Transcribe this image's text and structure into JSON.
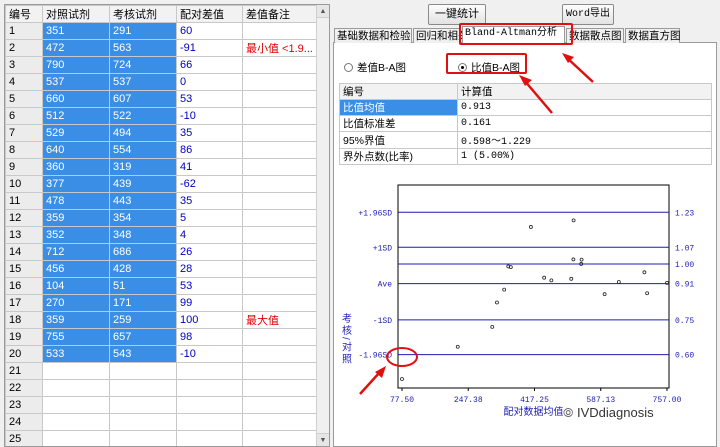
{
  "grid": {
    "headers": [
      "编号",
      "对照试剂",
      "考核试剂",
      "配对差值",
      "差值备注"
    ],
    "rows": [
      {
        "n": "1",
        "ref": "351",
        "test": "291",
        "diff": "60",
        "note": ""
      },
      {
        "n": "2",
        "ref": "472",
        "test": "563",
        "diff": "-91",
        "note": "最小值 <1.9..."
      },
      {
        "n": "3",
        "ref": "790",
        "test": "724",
        "diff": "66",
        "note": ""
      },
      {
        "n": "4",
        "ref": "537",
        "test": "537",
        "diff": "0",
        "note": ""
      },
      {
        "n": "5",
        "ref": "660",
        "test": "607",
        "diff": "53",
        "note": ""
      },
      {
        "n": "6",
        "ref": "512",
        "test": "522",
        "diff": "-10",
        "note": ""
      },
      {
        "n": "7",
        "ref": "529",
        "test": "494",
        "diff": "35",
        "note": ""
      },
      {
        "n": "8",
        "ref": "640",
        "test": "554",
        "diff": "86",
        "note": ""
      },
      {
        "n": "9",
        "ref": "360",
        "test": "319",
        "diff": "41",
        "note": ""
      },
      {
        "n": "10",
        "ref": "377",
        "test": "439",
        "diff": "-62",
        "note": ""
      },
      {
        "n": "11",
        "ref": "478",
        "test": "443",
        "diff": "35",
        "note": ""
      },
      {
        "n": "12",
        "ref": "359",
        "test": "354",
        "diff": "5",
        "note": ""
      },
      {
        "n": "13",
        "ref": "352",
        "test": "348",
        "diff": "4",
        "note": ""
      },
      {
        "n": "14",
        "ref": "712",
        "test": "686",
        "diff": "26",
        "note": ""
      },
      {
        "n": "15",
        "ref": "456",
        "test": "428",
        "diff": "28",
        "note": ""
      },
      {
        "n": "16",
        "ref": "104",
        "test": "51",
        "diff": "53",
        "note": ""
      },
      {
        "n": "17",
        "ref": "270",
        "test": "171",
        "diff": "99",
        "note": ""
      },
      {
        "n": "18",
        "ref": "359",
        "test": "259",
        "diff": "100",
        "note": "最大值"
      },
      {
        "n": "19",
        "ref": "755",
        "test": "657",
        "diff": "98",
        "note": ""
      },
      {
        "n": "20",
        "ref": "533",
        "test": "543",
        "diff": "-10",
        "note": ""
      },
      {
        "n": "21",
        "ref": "",
        "test": "",
        "diff": "",
        "note": ""
      },
      {
        "n": "22",
        "ref": "",
        "test": "",
        "diff": "",
        "note": ""
      },
      {
        "n": "23",
        "ref": "",
        "test": "",
        "diff": "",
        "note": ""
      },
      {
        "n": "24",
        "ref": "",
        "test": "",
        "diff": "",
        "note": ""
      },
      {
        "n": "25",
        "ref": "",
        "test": "",
        "diff": "",
        "note": ""
      }
    ]
  },
  "toolbar": {
    "stats_label": "一键统计",
    "word_label": "Word导出"
  },
  "tabs": [
    {
      "label": "基础数据和检验",
      "active": false
    },
    {
      "label": "回归和相关",
      "active": false
    },
    {
      "label": "Bland-Altman分析",
      "active": true
    },
    {
      "label": "数据散点图",
      "active": false
    },
    {
      "label": "数据直方图",
      "active": false
    }
  ],
  "radios": [
    {
      "label": "差值B-A图",
      "checked": false
    },
    {
      "label": "比值B-A图",
      "checked": true
    }
  ],
  "result": {
    "headers": [
      "编号",
      "计算值"
    ],
    "rows": [
      {
        "label": "比值均值",
        "value": "0.913",
        "selected": true
      },
      {
        "label": "比值标准差",
        "value": "0.161",
        "selected": false
      },
      {
        "label": "95%界值",
        "value": "0.598～1.229",
        "selected": false
      },
      {
        "label": "界外点数(比率)",
        "value": "1 (5.00%)",
        "selected": false
      }
    ]
  },
  "chart_data": {
    "type": "scatter",
    "xlabel": "配对数据均值",
    "ylabel": "考核/对照",
    "x_ticks": [
      "77.50",
      "247.38",
      "417.25",
      "587.13",
      "757.00"
    ],
    "xlim": [
      77.5,
      757.0
    ],
    "ylim": [
      0.45,
      1.35
    ],
    "hlines": [
      {
        "left": "+1.96SD",
        "right": "1.23",
        "value": 1.229
      },
      {
        "left": "+1SD",
        "right": "1.07",
        "value": 1.074
      },
      {
        "left": "",
        "right": "1.00",
        "value": 1.0
      },
      {
        "left": "Ave",
        "right": "0.91",
        "value": 0.913
      },
      {
        "left": "-1SD",
        "right": "0.75",
        "value": 0.752
      },
      {
        "left": "-1.96SD",
        "right": "0.60",
        "value": 0.598
      }
    ],
    "points": [
      {
        "x": 321,
        "y": 0.829
      },
      {
        "x": 517.5,
        "y": 1.193
      },
      {
        "x": 757,
        "y": 0.916
      },
      {
        "x": 537,
        "y": 1.0
      },
      {
        "x": 633.5,
        "y": 0.92
      },
      {
        "x": 517,
        "y": 1.02
      },
      {
        "x": 511.5,
        "y": 0.934
      },
      {
        "x": 597,
        "y": 0.866
      },
      {
        "x": 339.5,
        "y": 0.886
      },
      {
        "x": 408,
        "y": 1.164
      },
      {
        "x": 460.5,
        "y": 0.927
      },
      {
        "x": 356.5,
        "y": 0.986
      },
      {
        "x": 350,
        "y": 0.989
      },
      {
        "x": 699,
        "y": 0.963
      },
      {
        "x": 442,
        "y": 0.939
      },
      {
        "x": 77.5,
        "y": 0.49
      },
      {
        "x": 220.5,
        "y": 0.633
      },
      {
        "x": 309,
        "y": 0.721
      },
      {
        "x": 706,
        "y": 0.87
      },
      {
        "x": 538,
        "y": 1.019
      }
    ]
  },
  "watermark": "IVDdiagnosis"
}
